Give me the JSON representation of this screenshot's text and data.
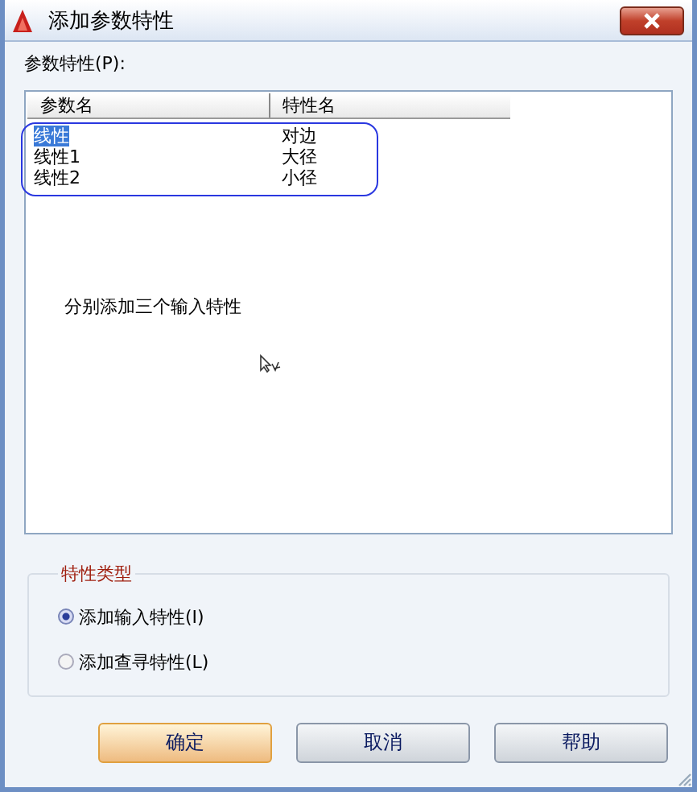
{
  "window": {
    "title": "添加参数特性"
  },
  "list_label": "参数特性(P):",
  "table": {
    "columns": [
      "参数名",
      "特性名"
    ],
    "rows": [
      {
        "cells": [
          "线性",
          "对边"
        ],
        "selected": true
      },
      {
        "cells": [
          "线性1",
          "大径"
        ],
        "selected": false
      },
      {
        "cells": [
          "线性2",
          "小径"
        ],
        "selected": false
      }
    ]
  },
  "annotation": "分别添加三个输入特性",
  "property_type": {
    "legend": "特性类型",
    "options": [
      {
        "label": "添加输入特性(I)",
        "selected": true
      },
      {
        "label": "添加查寻特性(L)",
        "selected": false
      }
    ]
  },
  "buttons": [
    {
      "label": "确定",
      "default": true
    },
    {
      "label": "取消",
      "default": false
    },
    {
      "label": "帮助",
      "default": false
    }
  ]
}
